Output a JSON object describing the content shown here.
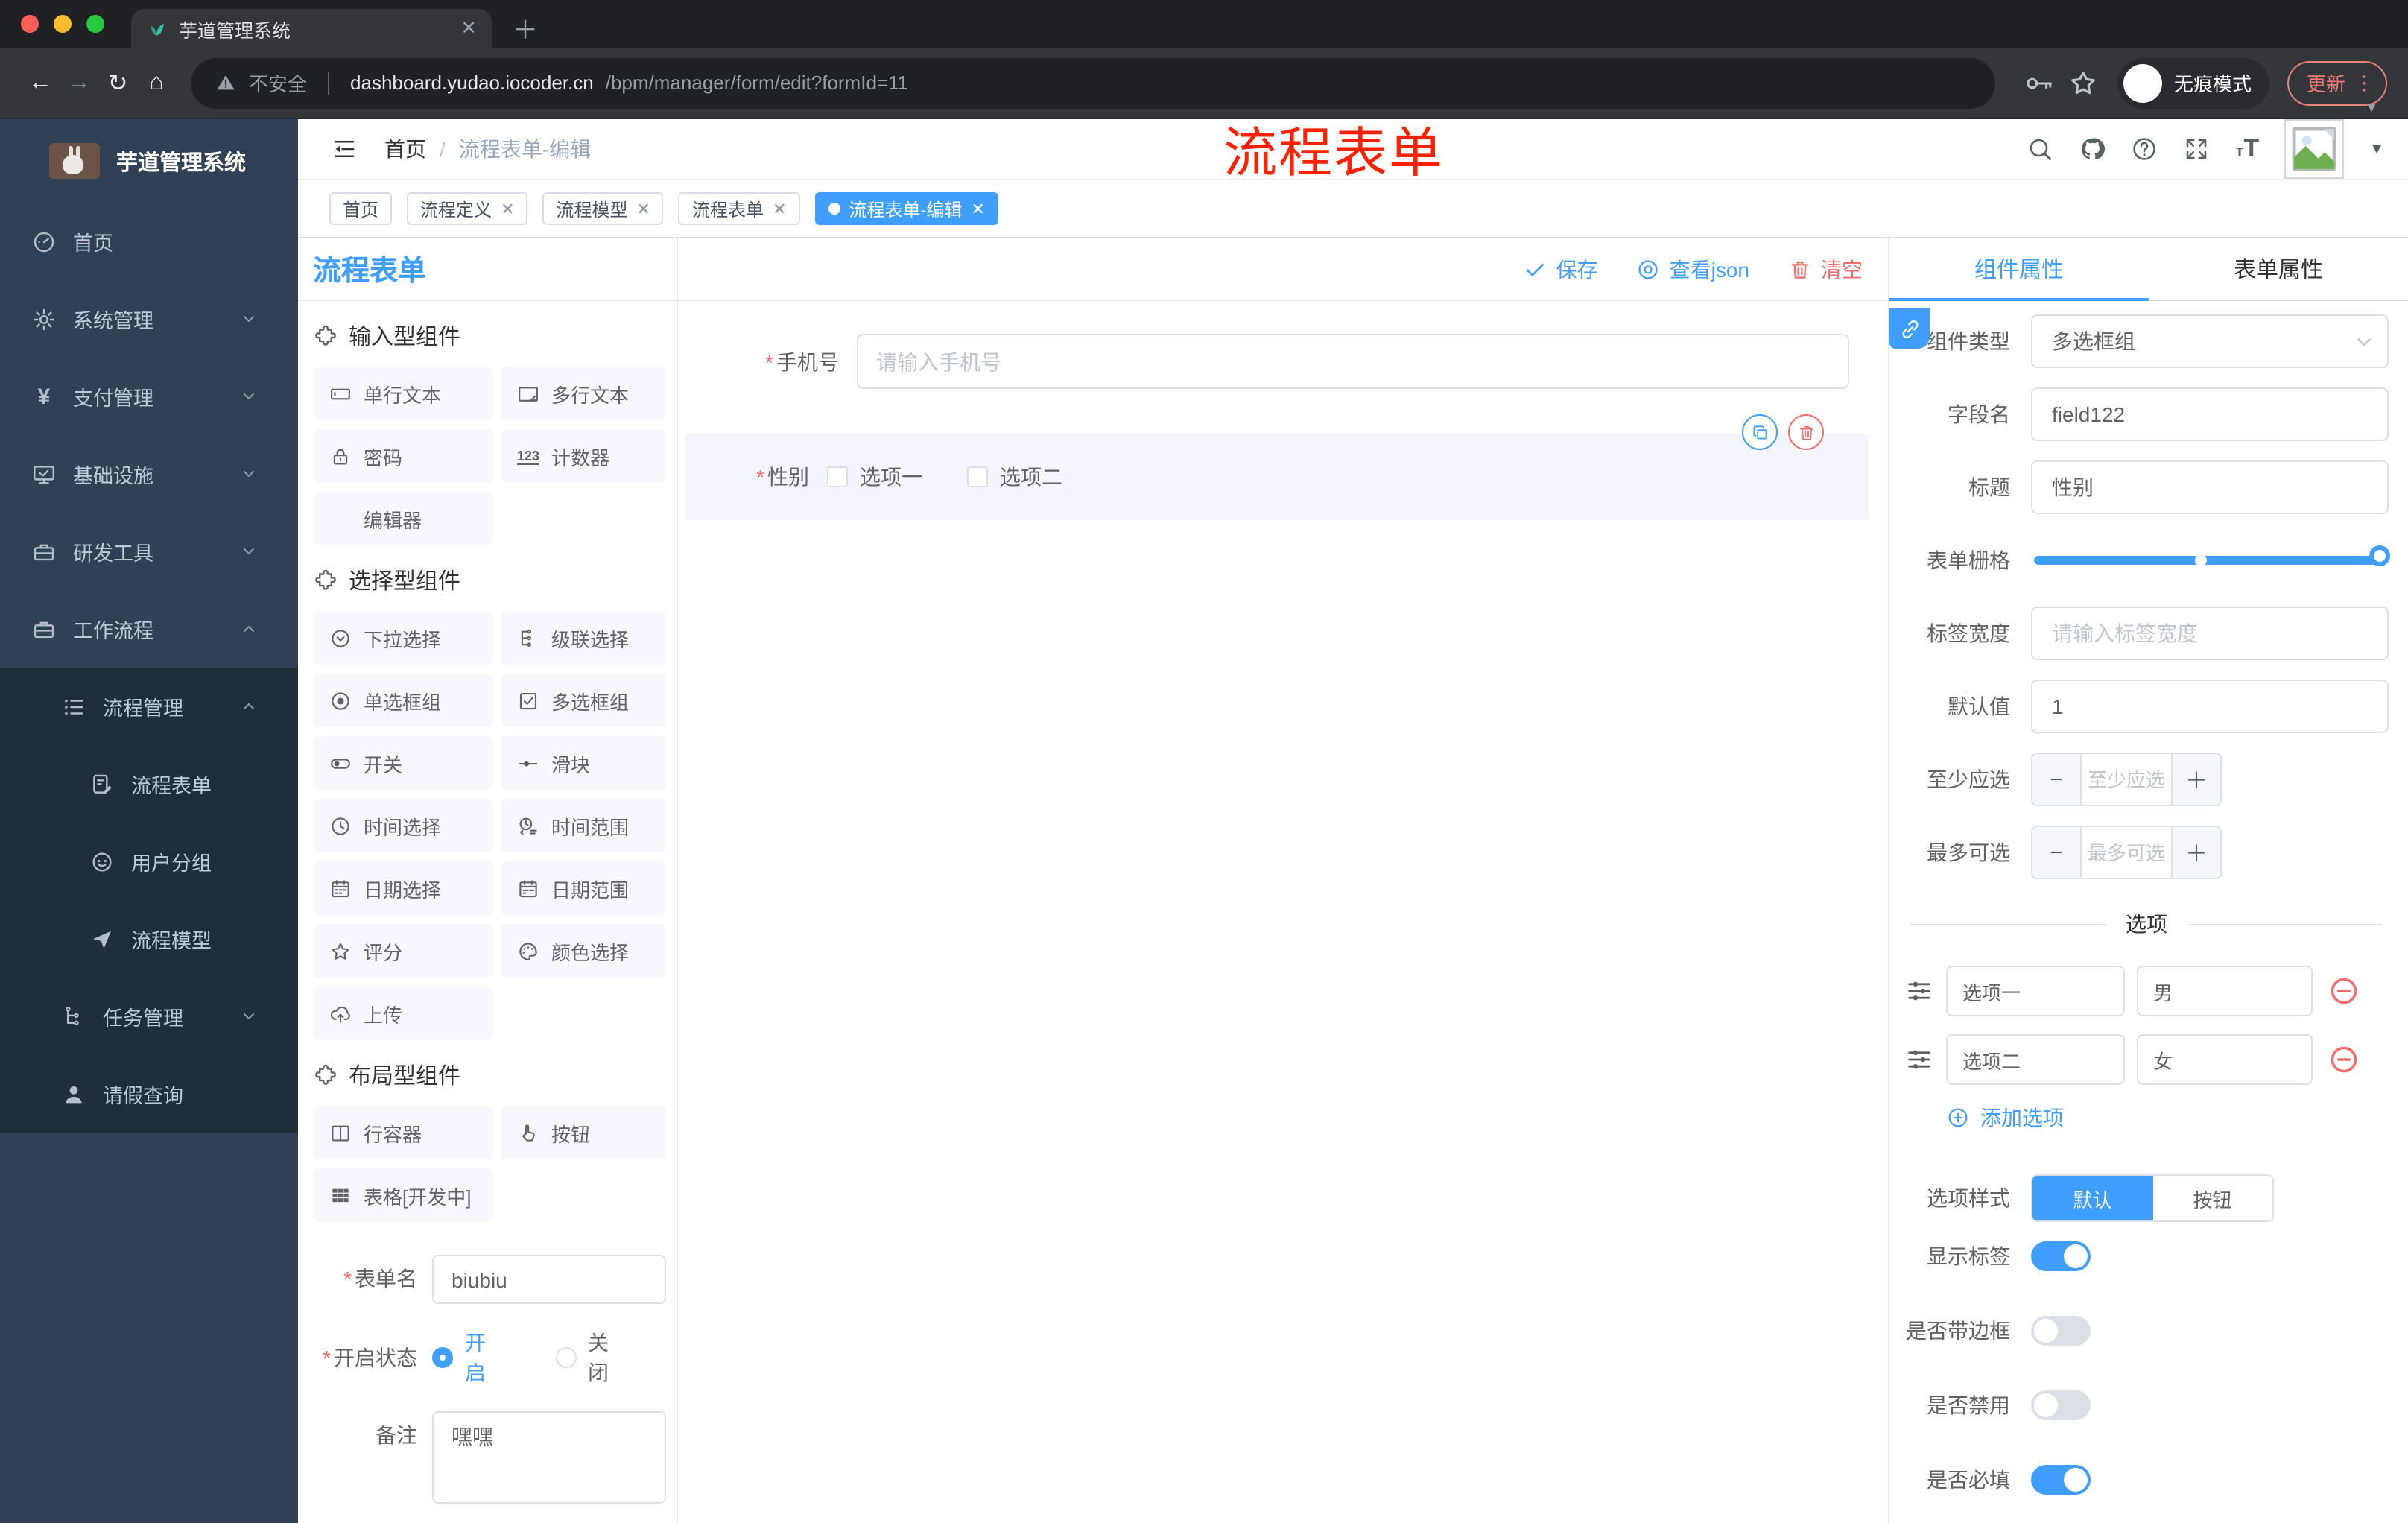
{
  "colors": {
    "primary": "#409EFF",
    "danger": "#F56C6C",
    "annotation_red": "#FF2000",
    "sidebar_bg": "#304156",
    "submenu_bg": "#1F2D3D",
    "active_tag": "#409EFF"
  },
  "browser": {
    "tab_title": "芋道管理系统",
    "security_label": "不安全",
    "url_host": "dashboard.yudao.iocoder.cn",
    "url_path": "/bpm/manager/form/edit?formId=11",
    "incognito_label": "无痕模式",
    "update_label": "更新"
  },
  "icons": {
    "favicon": "leaf-plant",
    "nav": [
      "back-arrow",
      "forward-arrow",
      "reload",
      "home"
    ],
    "url_bar": [
      "warning-triangle"
    ],
    "toolbar_right": [
      "key",
      "star-outline",
      "incognito",
      "more-vertical",
      "caret-down"
    ],
    "header_right": [
      "search",
      "github",
      "question-circle",
      "fullscreen",
      "font-size",
      "avatar-placeholder",
      "caret-down"
    ]
  },
  "sidebar": {
    "app_title": "芋道管理系统",
    "items": [
      {
        "label": "首页",
        "icon": "gauge"
      },
      {
        "label": "系统管理",
        "icon": "gear"
      },
      {
        "label": "支付管理",
        "icon": "yen"
      },
      {
        "label": "基础设施",
        "icon": "monitor"
      },
      {
        "label": "研发工具",
        "icon": "briefcase"
      },
      {
        "label": "工作流程",
        "icon": "briefcase"
      },
      {
        "label": "流程管理",
        "icon": "list"
      },
      {
        "label": "流程表单",
        "icon": "doc-edit"
      },
      {
        "label": "用户分组",
        "icon": "robot"
      },
      {
        "label": "流程模型",
        "icon": "paper-plane"
      },
      {
        "label": "任务管理",
        "icon": "tree"
      },
      {
        "label": "请假查询",
        "icon": "person"
      }
    ]
  },
  "header": {
    "breadcrumb_home": "首页",
    "breadcrumb_sep": "/",
    "breadcrumb_current": "流程表单-编辑",
    "annotation": "流程表单"
  },
  "tags": {
    "items": [
      {
        "label": "首页"
      },
      {
        "label": "流程定义"
      },
      {
        "label": "流程模型"
      },
      {
        "label": "流程表单"
      },
      {
        "label": "流程表单-编辑"
      }
    ]
  },
  "designer": {
    "panel_title": "流程表单",
    "toolbar": {
      "save": "保存",
      "view_json": "查看json",
      "clear": "清空"
    },
    "palette": {
      "sections": [
        {
          "title": "输入型组件",
          "items": [
            {
              "label": "单行文本",
              "icon": "input"
            },
            {
              "label": "多行文本",
              "icon": "textarea"
            },
            {
              "label": "密码",
              "icon": "lock"
            },
            {
              "label": "计数器",
              "icon": "counter-123"
            },
            {
              "label": "编辑器",
              "icon": "none"
            }
          ]
        },
        {
          "title": "选择型组件",
          "items": [
            {
              "label": "下拉选择",
              "icon": "circle-chevron-down"
            },
            {
              "label": "级联选择",
              "icon": "cascade"
            },
            {
              "label": "单选框组",
              "icon": "radio"
            },
            {
              "label": "多选框组",
              "icon": "checkbox"
            },
            {
              "label": "开关",
              "icon": "switch"
            },
            {
              "label": "滑块",
              "icon": "slider"
            },
            {
              "label": "时间选择",
              "icon": "clock"
            },
            {
              "label": "时间范围",
              "icon": "time-range"
            },
            {
              "label": "日期选择",
              "icon": "calendar"
            },
            {
              "label": "日期范围",
              "icon": "calendar-range"
            },
            {
              "label": "评分",
              "icon": "star"
            },
            {
              "label": "颜色选择",
              "icon": "palette"
            },
            {
              "label": "上传",
              "icon": "upload-cloud"
            }
          ]
        },
        {
          "title": "布局型组件",
          "items": [
            {
              "label": "行容器",
              "icon": "columns"
            },
            {
              "label": "按钮",
              "icon": "pointer"
            },
            {
              "label": "表格[开发中]",
              "icon": "table"
            }
          ]
        }
      ]
    },
    "meta": {
      "name_label": "表单名",
      "name_value": "biubiu",
      "status_label": "开启状态",
      "status_on": "开启",
      "status_off": "关闭",
      "remark_label": "备注",
      "remark_value": "嘿嘿"
    },
    "canvas": {
      "phone_label": "手机号",
      "phone_placeholder": "请输入手机号",
      "gender_label": "性别",
      "gender_option1": "选项一",
      "gender_option2": "选项二"
    },
    "props": {
      "tab_component": "组件属性",
      "tab_form": "表单属性",
      "type_label": "组件类型",
      "type_value": "多选框组",
      "field_label": "字段名",
      "field_value": "field122",
      "title_label": "标题",
      "title_value": "性别",
      "grid_label": "表单栅格",
      "label_width_label": "标签宽度",
      "label_width_placeholder": "请输入标签宽度",
      "default_label": "默认值",
      "default_value": "1",
      "min_label": "至少应选",
      "min_placeholder": "至少应选",
      "max_label": "最多可选",
      "max_placeholder": "最多可选",
      "options_title": "选项",
      "options": [
        {
          "label": "选项一",
          "value": "男"
        },
        {
          "label": "选项二",
          "value": "女"
        }
      ],
      "add_option": "添加选项",
      "style_label": "选项样式",
      "style_default": "默认",
      "style_button": "按钮",
      "show_label": "显示标签",
      "border_label": "是否带边框",
      "disabled_label": "是否禁用",
      "required_label": "是否必填"
    }
  }
}
